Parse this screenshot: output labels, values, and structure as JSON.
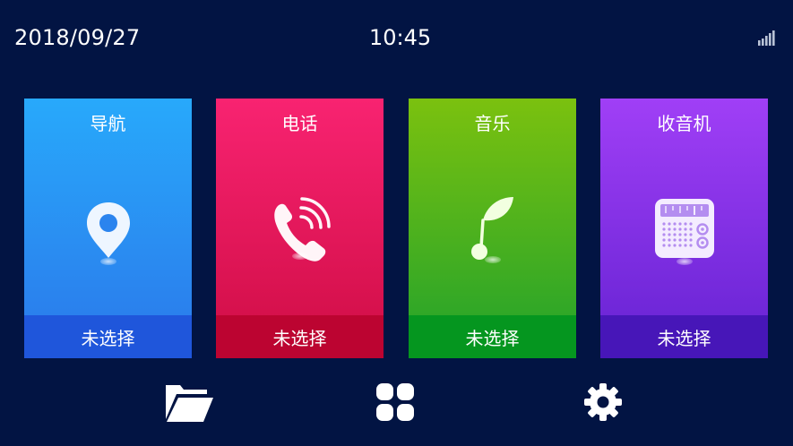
{
  "status_bar": {
    "date": "2018/09/27",
    "time": "10:45",
    "signal_icon": "signal-bars-icon"
  },
  "cards": [
    {
      "id": "nav",
      "title": "导航",
      "status": "未选择",
      "icon": "map-pin-icon",
      "color": "#28a9fb"
    },
    {
      "id": "phone",
      "title": "电话",
      "status": "未选择",
      "icon": "phone-ring-icon",
      "color": "#f82371"
    },
    {
      "id": "music",
      "title": "音乐",
      "status": "未选择",
      "icon": "music-note-icon",
      "color": "#7bc10f"
    },
    {
      "id": "radio",
      "title": "收音机",
      "status": "未选择",
      "icon": "radio-icon",
      "color": "#a03ff6"
    }
  ],
  "dock": [
    {
      "icon": "folder-icon"
    },
    {
      "icon": "apps-grid-icon"
    },
    {
      "icon": "gear-icon"
    }
  ],
  "colors": {
    "background": "#021443"
  }
}
